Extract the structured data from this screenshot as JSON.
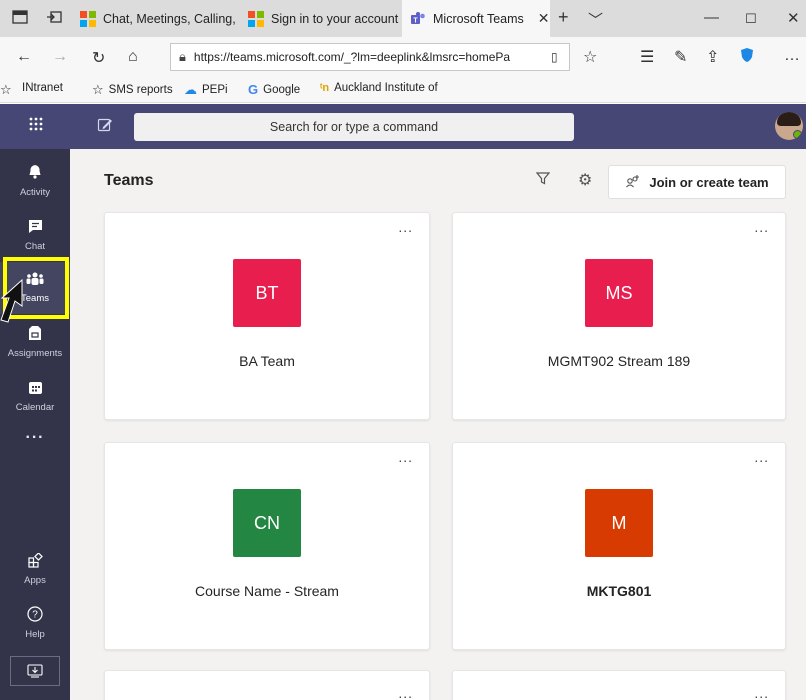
{
  "browser": {
    "tabs": [
      {
        "title": "Chat, Meetings, Calling,"
      },
      {
        "title": "Sign in to your account"
      },
      {
        "title": "Microsoft Teams"
      }
    ],
    "url": "https://teams.microsoft.com/_?lm=deeplink&lmsrc=homePa",
    "favorites": [
      {
        "label": "INtranet"
      },
      {
        "label": "SMS reports"
      },
      {
        "label": "PEPi"
      },
      {
        "label": "Google"
      },
      {
        "label": "Auckland Institute of"
      }
    ]
  },
  "teams": {
    "search_placeholder": "Search for or type a command",
    "page_title": "Teams",
    "join_label": "Join or create team",
    "rail": [
      {
        "label": "Activity"
      },
      {
        "label": "Chat"
      },
      {
        "label": "Teams"
      },
      {
        "label": "Assignments"
      },
      {
        "label": "Calendar"
      },
      {
        "label": "Apps"
      },
      {
        "label": "Help"
      }
    ],
    "cards": [
      {
        "initials": "BT",
        "name": "BA Team",
        "color": "#e81e4e"
      },
      {
        "initials": "MS",
        "name": "MGMT902 Stream 189",
        "color": "#e81e4e"
      },
      {
        "initials": "CN",
        "name": "Course Name - Stream",
        "color": "#238643"
      },
      {
        "initials": "M",
        "name": "MKTG801",
        "color": "#d83b01"
      }
    ],
    "more_label": "...",
    "accent": "#464775"
  }
}
